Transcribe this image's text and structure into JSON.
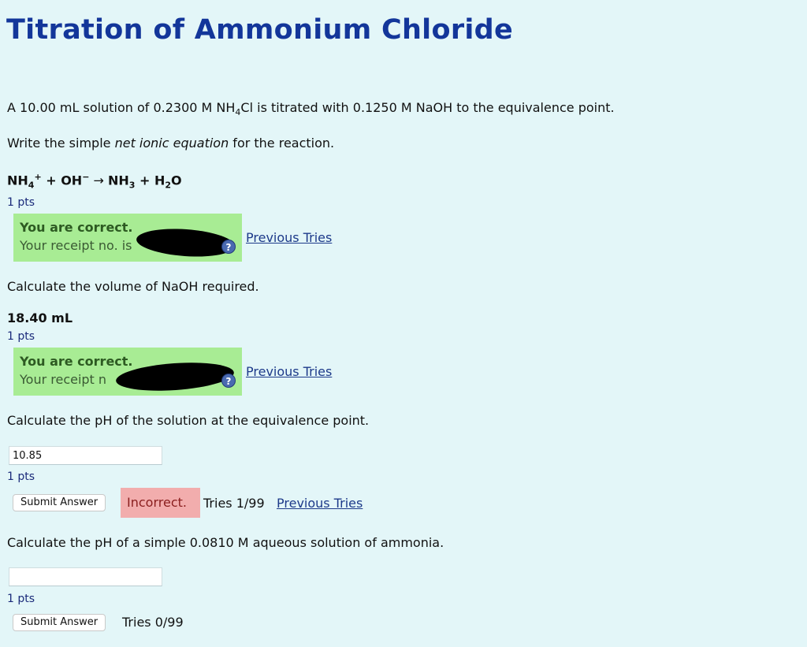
{
  "title": "Titration of Ammonium Chloride",
  "intro": {
    "pre": "A 10.00 mL solution of 0.2300 M NH",
    "sub": "4",
    "post": "Cl is titrated with 0.1250 M NaOH to the equivalence point."
  },
  "q1": {
    "prompt_pre": "Write the simple ",
    "prompt_em": "net ionic equation",
    "prompt_post": " for the reaction.",
    "answer": {
      "nh": "NH",
      "nh_sub": "4",
      "nh_sup": "+",
      "plus1": " + OH",
      "oh_sup": "−",
      "arrow": " → ",
      "nh3": "NH",
      "nh3_sub": "3",
      "plus2": " + H",
      "h2o_sub": "2",
      "o": "O"
    },
    "points": "1 pts",
    "feedback_title": "You are correct.",
    "feedback_receipt": "Your receipt no. is",
    "previous_tries": "Previous Tries"
  },
  "q2": {
    "prompt": "Calculate the volume of NaOH required.",
    "answer": "18.40 mL",
    "points": "1 pts",
    "feedback_title": "You are correct.",
    "feedback_receipt": "Your receipt n",
    "previous_tries": "Previous Tries"
  },
  "q3": {
    "prompt": "Calculate the pH of the solution at the equivalence point.",
    "input_value": "10.85",
    "points": "1 pts",
    "submit_label": "Submit Answer",
    "status": "Incorrect.",
    "tries": "Tries 1/99",
    "previous_tries": "Previous Tries"
  },
  "q4": {
    "prompt": "Calculate the pH of a simple 0.0810 M aqueous solution of ammonia.",
    "input_value": "",
    "points": "1 pts",
    "submit_label": "Submit Answer",
    "tries": "Tries 0/99"
  },
  "icons": {
    "help": "help-icon"
  },
  "colors": {
    "title": "#13369a",
    "correct_bg": "#a8ec94",
    "incorrect_bg": "#f2adad",
    "page_bg": "#e3f6f8"
  }
}
